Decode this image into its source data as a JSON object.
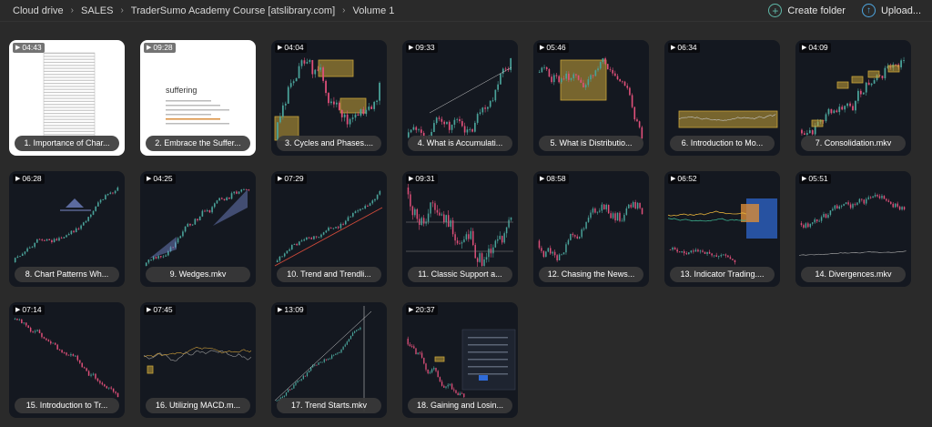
{
  "breadcrumb": [
    "Cloud drive",
    "SALES",
    "TraderSumo Academy Course [atslibrary.com]",
    "Volume 1"
  ],
  "actions": {
    "create_folder": "Create folder",
    "upload": "Upload..."
  },
  "files": [
    {
      "duration": "04:43",
      "name": "1. Importance of Char...",
      "thumb": "spreadsheet",
      "thumb_text": ""
    },
    {
      "duration": "09:28",
      "name": "2. Embrace the Suffer...",
      "thumb": "slide",
      "thumb_text": "suffering"
    },
    {
      "duration": "04:04",
      "name": "3. Cycles and Phases....",
      "thumb": "cycles",
      "thumb_text": ""
    },
    {
      "duration": "09:33",
      "name": "4. What is Accumulati...",
      "thumb": "accum",
      "thumb_text": ""
    },
    {
      "duration": "05:46",
      "name": "5. What is Distributio...",
      "thumb": "distrib",
      "thumb_text": ""
    },
    {
      "duration": "06:34",
      "name": "6. Introduction to Mo...",
      "thumb": "flat",
      "thumb_text": ""
    },
    {
      "duration": "04:09",
      "name": "7. Consolidation.mkv",
      "thumb": "consol",
      "thumb_text": ""
    },
    {
      "duration": "06:28",
      "name": "8. Chart Patterns Wh...",
      "thumb": "patterns",
      "thumb_text": ""
    },
    {
      "duration": "04:25",
      "name": "9. Wedges.mkv",
      "thumb": "wedges",
      "thumb_text": ""
    },
    {
      "duration": "07:29",
      "name": "10. Trend and Trendli...",
      "thumb": "trendline",
      "thumb_text": ""
    },
    {
      "duration": "09:31",
      "name": "11. Classic Support a...",
      "thumb": "support",
      "thumb_text": ""
    },
    {
      "duration": "08:58",
      "name": "12. Chasing the News...",
      "thumb": "news",
      "thumb_text": ""
    },
    {
      "duration": "06:52",
      "name": "13. Indicator Trading....",
      "thumb": "indicator",
      "thumb_text": ""
    },
    {
      "duration": "05:51",
      "name": "14. Divergences.mkv",
      "thumb": "diverg",
      "thumb_text": ""
    },
    {
      "duration": "07:14",
      "name": "15. Introduction to Tr...",
      "thumb": "downtrend",
      "thumb_text": ""
    },
    {
      "duration": "07:45",
      "name": "16. Utilizing MACD.m...",
      "thumb": "macd",
      "thumb_text": ""
    },
    {
      "duration": "13:09",
      "name": "17. Trend Starts.mkv",
      "thumb": "trendstart",
      "thumb_text": ""
    },
    {
      "duration": "20:37",
      "name": "18. Gaining and Losin...",
      "thumb": "dialog",
      "thumb_text": ""
    }
  ],
  "colors": {
    "background": "#2a2a2a",
    "tile": "#141820",
    "accent_green": "#5fb8a8",
    "accent_blue": "#4ea6e0",
    "candle_up": "#4aa39a",
    "candle_down": "#e0507a",
    "highlight": "#c8a63a"
  }
}
